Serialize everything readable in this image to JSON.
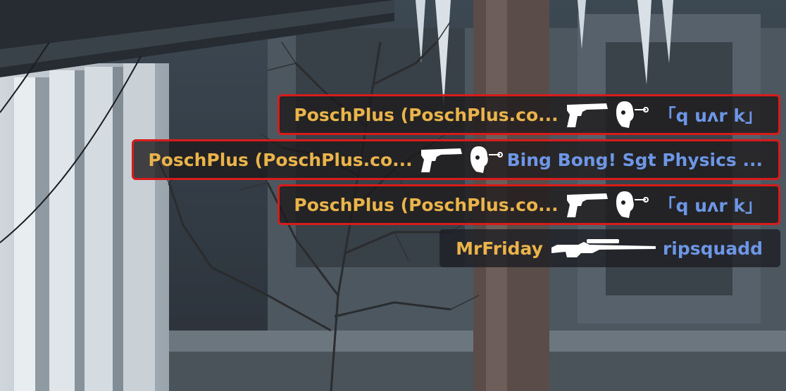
{
  "killfeed": {
    "entries": [
      {
        "attacker": "PoschPlus (PoschPlus.co...",
        "weapon": "pistol-icon",
        "headshot": true,
        "victim": "「q uʌr k」",
        "highlighted": true
      },
      {
        "attacker": "PoschPlus (PoschPlus.co...",
        "weapon": "pistol-icon",
        "headshot": true,
        "victim": "Bing Bong! Sgt Physics ...",
        "highlighted": true
      },
      {
        "attacker": "PoschPlus (PoschPlus.co...",
        "weapon": "pistol-icon",
        "headshot": true,
        "victim": "「q uʌr k」",
        "highlighted": true
      },
      {
        "attacker": "MrFriday",
        "weapon": "sniper-rifle-icon",
        "headshot": false,
        "victim": "ripsquadd",
        "highlighted": false
      }
    ]
  },
  "colors": {
    "attacker": "#eab44a",
    "victim": "#6d97e6",
    "highlight_border": "#d81c1c"
  }
}
